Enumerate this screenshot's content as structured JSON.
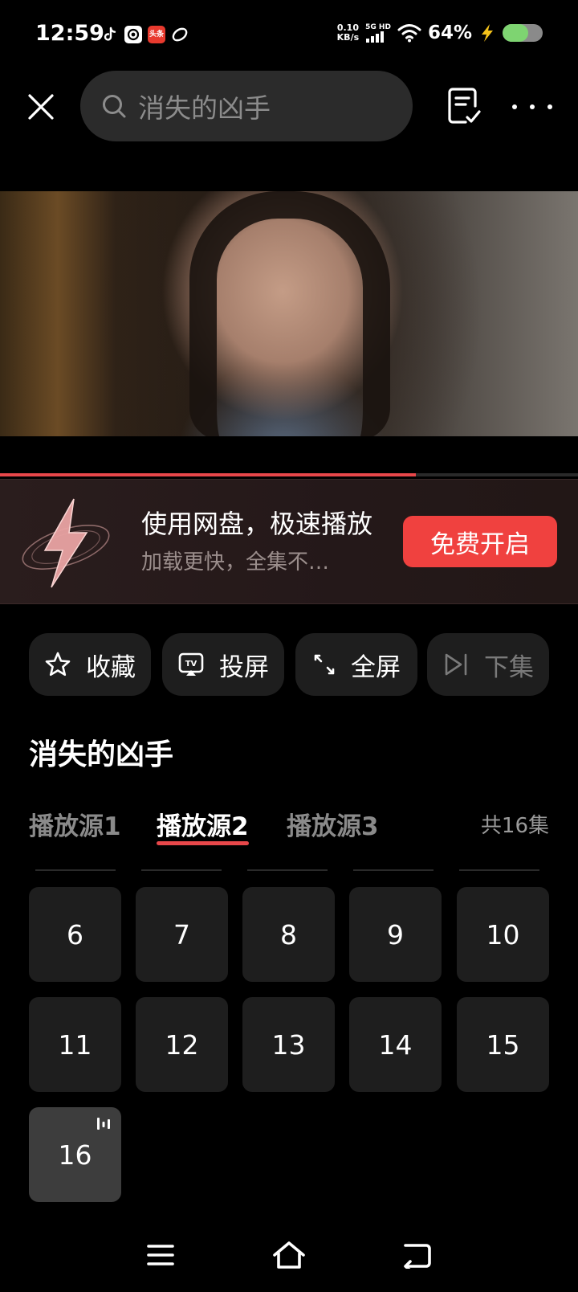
{
  "status_bar": {
    "time": "12:59",
    "net_speed_value": "0.10",
    "net_speed_unit": "KB/s",
    "signal_label": "5G HD",
    "battery_percent": "64%",
    "battery_level": 0.64,
    "battery_color": "#7ed471",
    "app_badge_text": "头条"
  },
  "header": {
    "search_text": "消失的凶手",
    "search_icon": "search-icon",
    "close_icon": "close-icon",
    "doc_icon": "document-check-icon",
    "more_icon": "more-horizontal-icon"
  },
  "player": {
    "progress": 0.72,
    "progress_color": "#e8474a"
  },
  "promo": {
    "title": "使用网盘，极速播放",
    "subtitle": "加载更快，全集不…",
    "button_label": "免费开启",
    "button_color": "#f0413f",
    "logo_icon": "lightning-icon"
  },
  "actions": [
    {
      "label": "收藏",
      "icon": "star-icon",
      "enabled": true
    },
    {
      "label": "投屏",
      "icon": "cast-tv-icon",
      "enabled": true
    },
    {
      "label": "全屏",
      "icon": "fullscreen-icon",
      "enabled": true
    },
    {
      "label": "下集",
      "icon": "next-episode-icon",
      "enabled": false
    }
  ],
  "show": {
    "title": "消失的凶手"
  },
  "sources": {
    "tabs": [
      "播放源1",
      "播放源2",
      "播放源3"
    ],
    "active_index": 1,
    "episode_count": "共16集"
  },
  "episodes": [
    "6",
    "7",
    "8",
    "9",
    "10",
    "11",
    "12",
    "13",
    "14",
    "15",
    "16"
  ],
  "current_episode": "16",
  "bottom_nav": {
    "menu_icon": "menu-icon",
    "home_icon": "home-icon",
    "back_icon": "back-icon"
  }
}
